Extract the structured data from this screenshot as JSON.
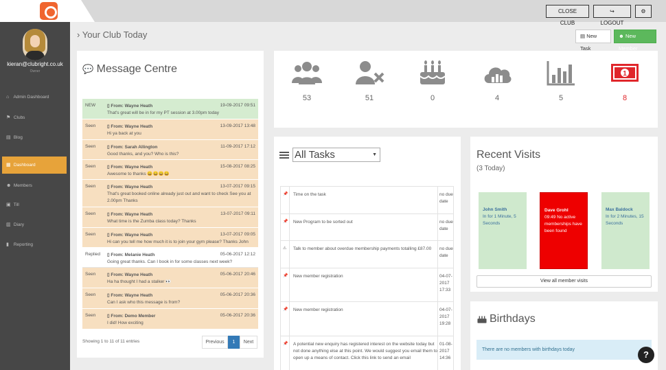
{
  "topbar": {
    "close_club": "CLOSE CLUB",
    "logout": "LOGOUT",
    "settings_glyph": "⚙",
    "logout_glyph": "↪"
  },
  "sidebar": {
    "email": "kieran@clubright.co.uk",
    "role": "Owner",
    "items": [
      {
        "label": "Admin Dashboard",
        "icon": "⌂"
      },
      {
        "label": "Clubs",
        "icon": "⚑"
      },
      {
        "label": "Blog",
        "icon": "▤"
      },
      {
        "label": "Dashboard",
        "icon": "▦"
      },
      {
        "label": "Members",
        "icon": "☻"
      },
      {
        "label": "Till",
        "icon": "▣"
      },
      {
        "label": "Diary",
        "icon": "▥"
      },
      {
        "label": "Reporting",
        "icon": "▮"
      }
    ],
    "active_index": 3
  },
  "header": {
    "title": "Your Club Today",
    "new_task": "New Task",
    "new_member": "New Member",
    "new_task_glyph": "▤",
    "new_member_glyph": "☻"
  },
  "messages": {
    "title": "Message Centre",
    "rows": [
      {
        "status": "NEW",
        "from": "▯ From: Wayne Heath",
        "date": "19-09-2017 09:51",
        "text": "That's great will be in for my PT session at 3.00pm today"
      },
      {
        "status": "Seen",
        "from": "▯ From: Wayne Heath",
        "date": "13-09-2017 13:48",
        "text": "Hi ya back at you"
      },
      {
        "status": "Seen",
        "from": "▯ From: Sarah Allington",
        "date": "11-09-2017 17:12",
        "text": "Good thanks, and you? Who is this?"
      },
      {
        "status": "Seen",
        "from": "▯ From: Wayne Heath",
        "date": "15-08-2017 08:25",
        "text": "Awesome to thanks 😄😄😄😄"
      },
      {
        "status": "Seen",
        "from": "▯ From: Wayne Heath",
        "date": "13-07-2017 09:15",
        "text": "That's great booked online already just out and want to check See you at 2.00pm Thanks"
      },
      {
        "status": "Seen",
        "from": "▯ From: Wayne Heath",
        "date": "13-07-2017 09:11",
        "text": "What time is the Zumba class today? Thanks"
      },
      {
        "status": "Seen",
        "from": "▯ From: Wayne Heath",
        "date": "13-07-2017 09:05",
        "text": "Hi can you tell me how much it is to join your gym please? Thanks John"
      },
      {
        "status": "Replied",
        "from": "▯ From: Melanie Heath",
        "date": "05-06-2017 12:12",
        "text": "Going great thanks. Can I book in for some classes next week?"
      },
      {
        "status": "Seen",
        "from": "▯ From: Wayne Heath",
        "date": "05-06-2017 20:46",
        "text": "Ha ha thought I had a stalker 👀"
      },
      {
        "status": "Seen",
        "from": "▯ From: Wayne Heath",
        "date": "05-06-2017 20:36",
        "text": "Can I ask who this message is from?"
      },
      {
        "status": "Seen",
        "from": "▯ From: Demo Member",
        "date": "05-06-2017 20:36",
        "text": "I did! How exciting"
      }
    ],
    "showing": "Showing 1 to 11 of 11 entries",
    "prev": "Previous",
    "page": "1",
    "next": "Next"
  },
  "stats": [
    {
      "icon": "members-group-icon",
      "value": "53"
    },
    {
      "icon": "member-remove-icon",
      "value": "51"
    },
    {
      "icon": "birthday-cake-icon",
      "value": "0"
    },
    {
      "icon": "cloud-upload-icon",
      "value": "4"
    },
    {
      "icon": "bar-chart-icon",
      "value": "5"
    },
    {
      "icon": "money-icon",
      "value": "8",
      "color": "#e0262b"
    }
  ],
  "tasks": {
    "filter": "All Tasks",
    "rows": [
      {
        "pin": "📌",
        "text": "Time on the task",
        "date": "no due date"
      },
      {
        "pin": "📌",
        "text": "New Program to be sorted out",
        "date": "no due date"
      },
      {
        "pin": "⚠",
        "text": "Talk to member about overdue membership payments totalling £87.00",
        "date": "no due date"
      },
      {
        "pin": "📌",
        "text": "New member registration",
        "date": "04-07-2017 17:33"
      },
      {
        "pin": "📌",
        "text": "New member registration",
        "date": "04-07-2017 19:28"
      },
      {
        "pin": "📌",
        "text": "A potential new enquiry has registered interest on the website today but not done anything else at this point. We would suggest you email them to open up a means of contact. Click this link to send an email",
        "date": "01-08-2017 14:36"
      }
    ]
  },
  "visits": {
    "title": "Recent Visits",
    "subtitle": "(3 Today)",
    "cards": [
      {
        "name": "John Smith",
        "detail": "In for 1 Minute, 5 Seconds",
        "color": "#cfe9cd"
      },
      {
        "name": "Dave Grohl",
        "detail": "09:49 No active memberships have been found",
        "color": "#ee0000"
      },
      {
        "name": "Max Baldock",
        "detail": "In for 2 Minutes, 15 Seconds",
        "color": "#cfe9cd"
      }
    ],
    "view_all": "View all member visits"
  },
  "birthdays": {
    "title": "Birthdays",
    "empty": "There are no members with birthdays today"
  },
  "help": "?"
}
